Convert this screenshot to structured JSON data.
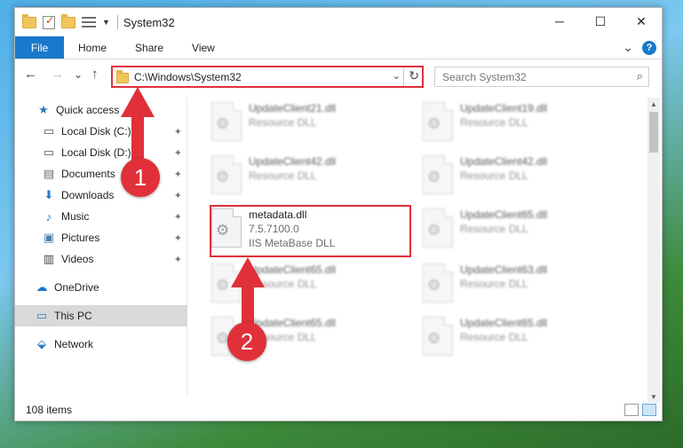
{
  "window": {
    "title": "System32",
    "quick_access_toolbar": [
      "folder-icon",
      "properties-icon",
      "new-folder-icon",
      "view-menu-icon"
    ],
    "controls": {
      "minimize": "─",
      "maximize": "☐",
      "close": "✕"
    }
  },
  "ribbon": {
    "tabs": [
      "File",
      "Home",
      "Share",
      "View"
    ],
    "expand_glyph": "⌄",
    "help_glyph": "?"
  },
  "navbar": {
    "back": "←",
    "forward": "→",
    "recent": "⌄",
    "up": "↑",
    "address": "C:\\Windows\\System32",
    "refresh": "↻",
    "search_placeholder": "Search System32"
  },
  "sidebar": {
    "items": [
      {
        "label": "Quick access",
        "icon": "star-icon",
        "glyph": "★",
        "pinned": false
      },
      {
        "label": "Local Disk (C:)",
        "icon": "drive-icon",
        "glyph": "▭",
        "pinned": true
      },
      {
        "label": "Local Disk (D:)",
        "icon": "drive-icon",
        "glyph": "▭",
        "pinned": true
      },
      {
        "label": "Documents",
        "icon": "documents-icon",
        "glyph": "▤",
        "pinned": true
      },
      {
        "label": "Downloads",
        "icon": "downloads-icon",
        "glyph": "⬇",
        "pinned": true
      },
      {
        "label": "Music",
        "icon": "music-icon",
        "glyph": "♪",
        "pinned": true
      },
      {
        "label": "Pictures",
        "icon": "pictures-icon",
        "glyph": "▣",
        "pinned": true
      },
      {
        "label": "Videos",
        "icon": "videos-icon",
        "glyph": "▥",
        "pinned": true
      },
      {
        "label": "OneDrive",
        "icon": "onedrive-icon",
        "glyph": "☁",
        "pinned": false
      },
      {
        "label": "This PC",
        "icon": "this-pc-icon",
        "glyph": "▭",
        "pinned": false,
        "selected": true
      },
      {
        "label": "Network",
        "icon": "network-icon",
        "glyph": "⬙",
        "pinned": false
      }
    ],
    "pin_glyph": "📌"
  },
  "files": {
    "left": [
      {
        "name": "UpdateClient21.dll",
        "line2": "Resource DLL",
        "blurred": true
      },
      {
        "name": "UpdateClient42.dll",
        "line2": "Resource DLL",
        "blurred": true
      },
      {
        "name": "metadata.dll",
        "line2": "7.5.7100.0",
        "line3": "IIS MetaBase DLL",
        "blurred": false,
        "highlighted": true
      },
      {
        "name": "UpdateClient65.dll",
        "line2": "Resource DLL",
        "blurred": true
      },
      {
        "name": "UpdateClient65.dll",
        "line2": "Resource DLL",
        "blurred": true
      }
    ],
    "right": [
      {
        "name": "UpdateClient19.dll",
        "line2": "Resource DLL",
        "blurred": true
      },
      {
        "name": "UpdateClient42.dll",
        "line2": "Resource DLL",
        "blurred": true
      },
      {
        "name": "UpdateClient65.dll",
        "line2": "Resource DLL",
        "blurred": true
      },
      {
        "name": "UpdateClient63.dll",
        "line2": "Resource DLL",
        "blurred": true
      },
      {
        "name": "UpdateClient65.dll",
        "line2": "Resource DLL",
        "blurred": true
      }
    ]
  },
  "status": {
    "item_count": "108 items"
  },
  "annotations": {
    "marker1": "1",
    "marker2": "2",
    "color": "#e0303a"
  }
}
